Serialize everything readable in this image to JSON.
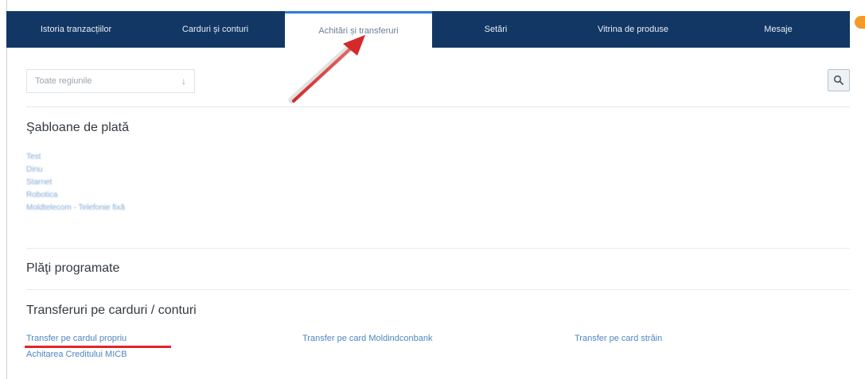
{
  "nav": {
    "tabs": [
      {
        "label": "Istoria tranzacțiilor"
      },
      {
        "label": "Carduri și conturi"
      },
      {
        "label": "Achitări și transferuri",
        "active": true
      },
      {
        "label": "Setări"
      },
      {
        "label": "Vitrina de produse"
      },
      {
        "label": "Mesaje"
      }
    ]
  },
  "filter": {
    "region_select_value": "Toate regiunile",
    "arrow_glyph": "↓"
  },
  "sections": {
    "templates_title": "Şabloane de plată",
    "templates": [
      "Test",
      "Dinu",
      "Starnet",
      "Robotica",
      "Moldtelecom - Telefonie fixă"
    ],
    "scheduled_title": "Plăţi programate",
    "transfers_title": "Transferuri pe carduri / conturi",
    "transfers": {
      "own_card": "Transfer pe cardul propriu",
      "moldindconbank": "Transfer pe card Moldindconbank",
      "foreign_card": "Transfer pe card străin",
      "micb_credit": "Achitarea Creditului MICB"
    }
  },
  "colors": {
    "nav_bg": "#123764",
    "link": "#4f86c0",
    "annotation": "#e0262c",
    "badge": "#f39a2a"
  },
  "icons": {
    "search": "search-icon"
  }
}
